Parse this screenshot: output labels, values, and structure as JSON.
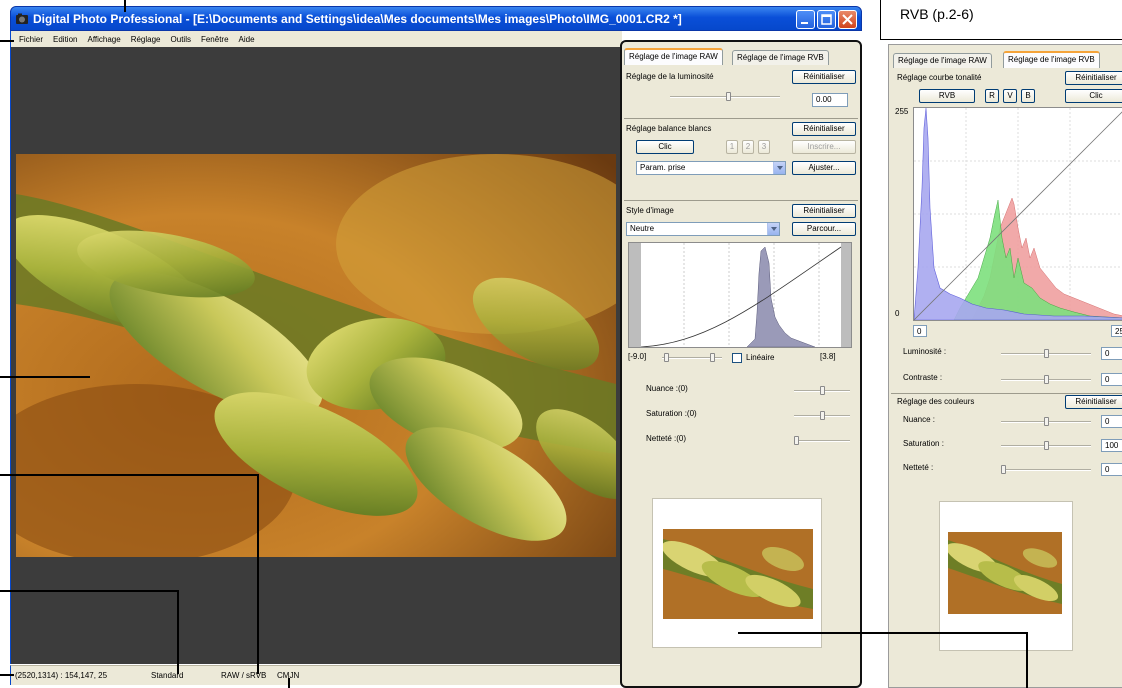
{
  "app": {
    "title": "Digital Photo Professional - [E:\\Documents and Settings\\idea\\Mes documents\\Mes images\\Photo\\IMG_0001.CR2 *]"
  },
  "menu": [
    "Fichier",
    "Edition",
    "Affichage",
    "Réglage",
    "Outils",
    "Fenêtre",
    "Aide"
  ],
  "status": {
    "coords": "(2520,1314) : 154,147, 25",
    "style": "Standard",
    "mode": "RAW / sRVB",
    "cmjn": "CMJN"
  },
  "note": "RVB (p.2-6)",
  "raw_panel": {
    "tab_raw": "Réglage de l'image RAW",
    "tab_rgb": "Réglage de l'image RVB",
    "brightness_title": "Réglage de la luminosité",
    "reset": "Réinitialiser",
    "brightness_value": "0.00",
    "wb_title": "Réglage balance blancs",
    "click": "Clic",
    "wb_nums": [
      "1",
      "2",
      "3"
    ],
    "register": "Inscrire...",
    "wb_select": "Param. prise",
    "adjust": "Ajuster...",
    "style_title": "Style d'image",
    "style_select": "Neutre",
    "browse": "Parcour...",
    "range_min": "[-9.0]",
    "range_max": "[3.8]",
    "linear": "Linéaire",
    "nuance": "Nuance :(0)",
    "saturation": "Saturation :(0)",
    "nettete": "Netteté :(0)"
  },
  "rgb_panel": {
    "tab_raw": "Réglage de l'image RAW",
    "tab_rgb": "Réglage de l'image RVB",
    "curve_title": "Réglage courbe tonalité",
    "reset": "Réinitialiser",
    "rgb_btn": "RVB",
    "r": "R",
    "v": "V",
    "b": "B",
    "click": "Clic",
    "hist_max": "255",
    "hist_zero": "0",
    "in_min": "0",
    "in_max": "25",
    "luminosite": "Luminosité :",
    "luminosite_val": "0",
    "contraste": "Contraste :",
    "contraste_val": "0",
    "color_title": "Réglage des couleurs",
    "nuance": "Nuance :",
    "nuance_val": "0",
    "saturation": "Saturation :",
    "saturation_val": "100",
    "nettete": "Netteté :",
    "nettete_val": "0"
  }
}
